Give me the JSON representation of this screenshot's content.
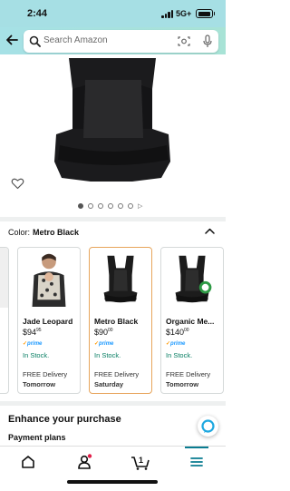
{
  "status_bar": {
    "time": "2:44",
    "carrier": "5G+"
  },
  "search": {
    "placeholder": "Search Amazon"
  },
  "color_selector": {
    "label": "Color:",
    "selected": "Metro Black",
    "options": [
      {
        "name": "Jade Leopard",
        "price_whole": "$94",
        "price_fraction": "95",
        "prime": "prime",
        "stock": "In Stock.",
        "delivery": "FREE Delivery",
        "day": "Tomorrow"
      },
      {
        "name": "Metro Black",
        "price_whole": "$90",
        "price_fraction": "00",
        "prime": "prime",
        "stock": "In Stock.",
        "delivery": "FREE Delivery",
        "day": "Saturday"
      },
      {
        "name": "Organic Me...",
        "price_whole": "$140",
        "price_fraction": "00",
        "prime": "prime",
        "stock": "In Stock.",
        "delivery": "FREE Delivery",
        "day": "Tomorrow"
      }
    ]
  },
  "sections": {
    "enhance": "Enhance your purchase",
    "payment": "Payment plans"
  },
  "tab_bar": {
    "cart_count": "1"
  },
  "colors": {
    "header_bg": "#a6dfe4",
    "prime_blue": "#1a98ff",
    "stock_green": "#067d62",
    "selected_border": "#e7a45a",
    "accent_teal": "#0a7c91"
  },
  "icons": [
    "back-icon",
    "search-icon",
    "camera-icon",
    "mic-icon",
    "heart-icon",
    "chevron-up-icon",
    "alexa-icon",
    "home-icon",
    "account-icon",
    "cart-icon",
    "menu-icon"
  ]
}
